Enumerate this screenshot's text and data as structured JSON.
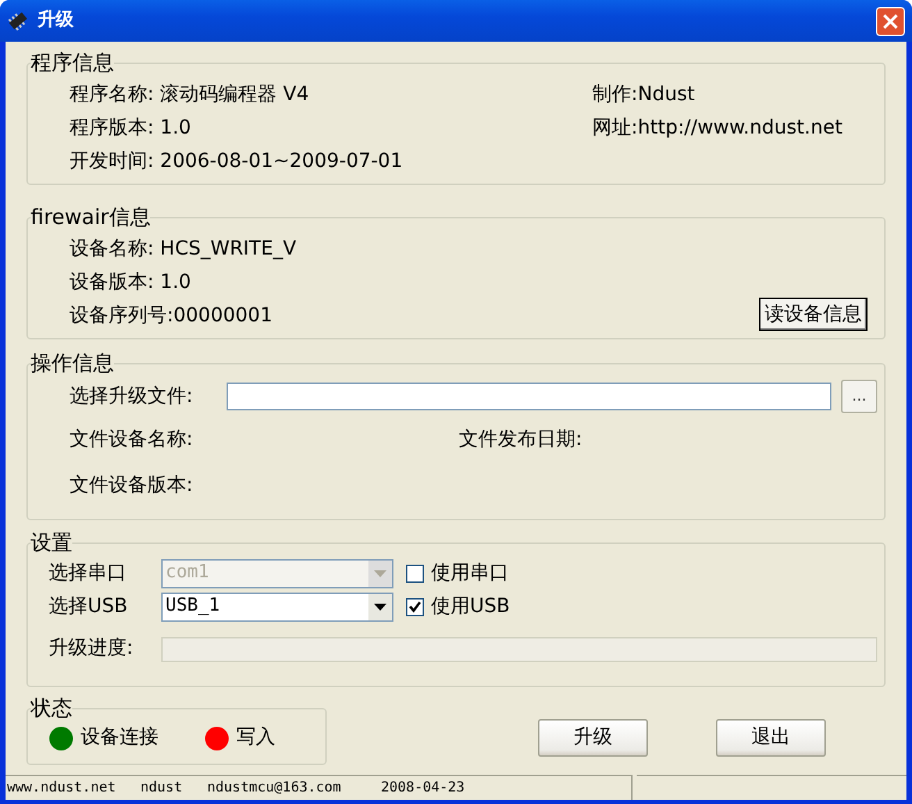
{
  "window": {
    "title": "升级"
  },
  "program_info": {
    "title": "程序信息",
    "lines": [
      "程序名称: 滚动码编程器 V4",
      "程序版本: 1.0",
      "开发时间: 2006-08-01~2009-07-01"
    ],
    "right_lines": [
      "制作:Ndust",
      "网址:http://www.ndust.net"
    ]
  },
  "firmware_info": {
    "title": "firewair信息",
    "lines": [
      "设备名称: HCS_WRITE_V",
      "设备版本: 1.0",
      "设备序列号:00000001"
    ],
    "button": "读设备信息"
  },
  "operation": {
    "title": "操作信息",
    "file_label": "选择升级文件:",
    "browse_button": "...",
    "device_name_label": "文件设备名称:",
    "release_date_label": "文件发布日期:",
    "device_version_label": "文件设备版本:"
  },
  "settings": {
    "title": "设置",
    "ports": [
      {
        "label": "选择串口",
        "value": "com1",
        "disabled": true,
        "checkbox": "使用串口",
        "checked": false
      },
      {
        "label": "选择USB",
        "value": "USB_1",
        "disabled": false,
        "checkbox": "使用USB",
        "checked": true
      }
    ],
    "progress_label": "升级进度:",
    "level": 0
  },
  "status": {
    "title": "状态",
    "indicators": [
      {
        "label": "设备连接",
        "color": "#007a00"
      },
      {
        "label": "写入",
        "color": "#ff0000"
      }
    ]
  },
  "buttons": [
    "升级",
    "退出"
  ],
  "status_bar": [
    "www.ndust.net",
    "ndust",
    "ndustmcu@163.com",
    "2008-04-23"
  ]
}
